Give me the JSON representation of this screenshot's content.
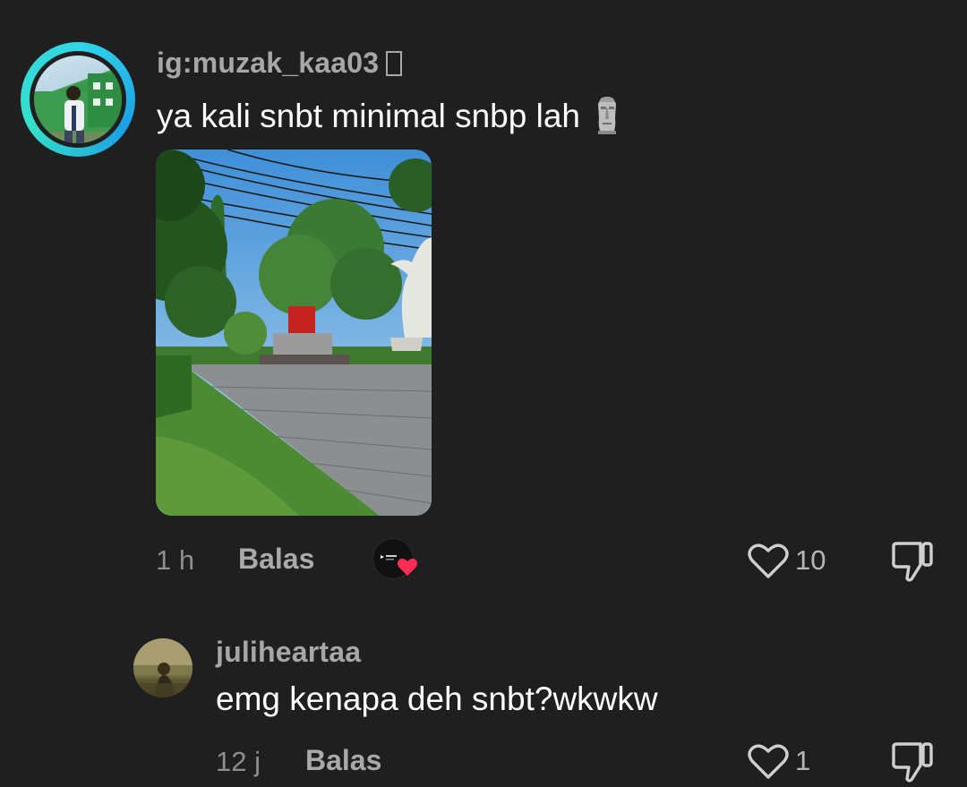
{
  "comments": [
    {
      "username": "ig:muzak_kaa03",
      "text": "ya kali snbt minimal snbp lah",
      "emoji": "moai-icon",
      "time": "1 h",
      "reply_label": "Balas",
      "likes": "10",
      "avatar_ring_colors": [
        "#31d6e8",
        "#1aa0e6",
        "#35e0c9"
      ]
    },
    {
      "username": "juliheartaa",
      "text": "emg kenapa deh snbt?wkwkw",
      "time": "12 j",
      "reply_label": "Balas",
      "likes": "1"
    }
  ],
  "colors": {
    "background": "#1f1f1f",
    "username": "#a7a7a7",
    "text": "#ffffff",
    "meta": "#8e8e8e",
    "like_heart_sticker": "#ff2d55"
  }
}
